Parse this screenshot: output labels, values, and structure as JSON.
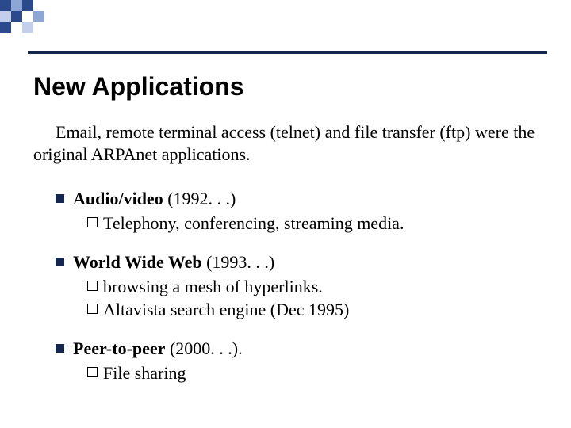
{
  "title": "New Applications",
  "intro": "Email, remote terminal access (telnet) and file transfer (ftp) were the original ARPAnet applications.",
  "items": [
    {
      "heading_bold": "Audio/video",
      "heading_rest": " (1992. . .)",
      "sub": [
        "Telephony, conferencing, streaming media."
      ]
    },
    {
      "heading_bold": "World Wide Web",
      "heading_rest": " (1993. . .)",
      "sub": [
        "browsing a mesh of hyperlinks.",
        "Altavista search engine (Dec 1995)"
      ]
    },
    {
      "heading_bold": "Peer-to-peer",
      "heading_rest": " (2000. . .).",
      "sub": [
        "File sharing"
      ]
    }
  ]
}
